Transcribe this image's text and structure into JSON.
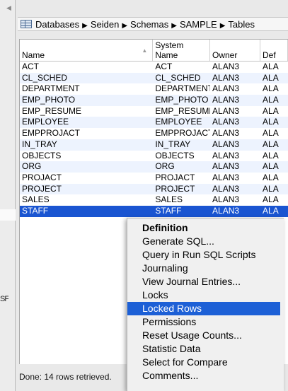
{
  "breadcrumb": {
    "icon": "table-grid-icon",
    "items": [
      "Databases",
      "Seiden",
      "Schemas",
      "SAMPLE",
      "Tables"
    ],
    "separator": "▶"
  },
  "left_pane": {
    "truncated_text": "SF"
  },
  "table": {
    "columns": [
      {
        "line1": "",
        "line2": "Name"
      },
      {
        "line1": "System",
        "line2": "Name"
      },
      {
        "line1": "",
        "line2": "Owner"
      },
      {
        "line1": "",
        "line2": "Def"
      }
    ],
    "rows": [
      [
        "ACT",
        "ACT",
        "ALAN3",
        "ALA"
      ],
      [
        "CL_SCHED",
        "CL_SCHED",
        "ALAN3",
        "ALA"
      ],
      [
        "DEPARTMENT",
        "DEPARTMENT",
        "ALAN3",
        "ALA"
      ],
      [
        "EMP_PHOTO",
        "EMP_PHOTO",
        "ALAN3",
        "ALA"
      ],
      [
        "EMP_RESUME",
        "EMP_RESUME",
        "ALAN3",
        "ALA"
      ],
      [
        "EMPLOYEE",
        "EMPLOYEE",
        "ALAN3",
        "ALA"
      ],
      [
        "EMPPROJACT",
        "EMPPROJACT",
        "ALAN3",
        "ALA"
      ],
      [
        "IN_TRAY",
        "IN_TRAY",
        "ALAN3",
        "ALA"
      ],
      [
        "OBJECTS",
        "OBJECTS",
        "ALAN3",
        "ALA"
      ],
      [
        "ORG",
        "ORG",
        "ALAN3",
        "ALA"
      ],
      [
        "PROJACT",
        "PROJACT",
        "ALAN3",
        "ALA"
      ],
      [
        "PROJECT",
        "PROJECT",
        "ALAN3",
        "ALA"
      ],
      [
        "SALES",
        "SALES",
        "ALAN3",
        "ALA"
      ],
      [
        "STAFF",
        "STAFF",
        "ALAN3",
        "ALA"
      ]
    ],
    "selected_row": 13
  },
  "status": {
    "text": "Done: 14 rows retrieved."
  },
  "context_menu": {
    "items": [
      {
        "label": "Definition",
        "bold": true
      },
      {
        "label": "Generate SQL..."
      },
      {
        "label": "Query in Run SQL Scripts"
      },
      {
        "label": "Journaling"
      },
      {
        "label": "View Journal Entries..."
      },
      {
        "label": "Locks"
      },
      {
        "label": "Locked Rows",
        "highlighted": true
      },
      {
        "label": "Permissions"
      },
      {
        "label": "Reset Usage Counts..."
      },
      {
        "label": "Statistic Data"
      },
      {
        "label": "Select for Compare"
      },
      {
        "label": "Comments..."
      }
    ]
  },
  "colors": {
    "selection": "#1a55d1",
    "menu_highlight": "#1d60d6",
    "stripe": "#edf3fe"
  }
}
